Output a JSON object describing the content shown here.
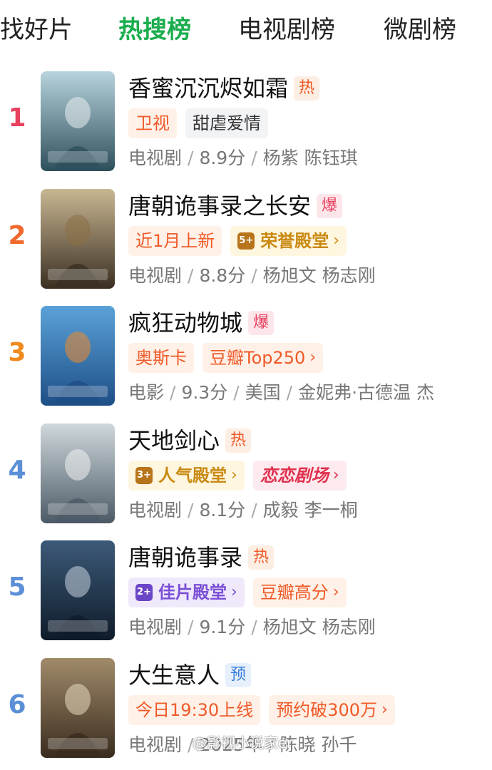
{
  "tabs": [
    {
      "label": "找好片",
      "active": false
    },
    {
      "label": "热搜榜",
      "active": true
    },
    {
      "label": "电视剧榜",
      "active": false
    },
    {
      "label": "微剧榜",
      "active": false
    }
  ],
  "items": [
    {
      "rank": "1",
      "rank_color": "#e8405f",
      "title": "香蜜沉沉烬如霜",
      "badge": "热",
      "badge_style": "hot",
      "tags": [
        {
          "text": "卫视",
          "style": "orange"
        },
        {
          "text": "甜虐爱情",
          "style": "gray"
        }
      ],
      "meta": [
        "电视剧",
        "8.9分",
        "杨紫 陈钰琪"
      ],
      "poster": {
        "bg1": "#b7d4dc",
        "bg2": "#2e4f5c",
        "accent": "#e9eef0"
      }
    },
    {
      "rank": "2",
      "rank_color": "#ef6a2c",
      "title": "唐朝诡事录之长安",
      "badge": "爆",
      "badge_style": "boom",
      "tags": [
        {
          "text": "近1月上新",
          "style": "orange"
        },
        {
          "text": "荣誉殿堂",
          "style": "gold",
          "medal": "5+",
          "chevron": true
        }
      ],
      "meta": [
        "电视剧",
        "8.8分",
        "杨旭文 杨志刚"
      ],
      "poster": {
        "bg1": "#c9b793",
        "bg2": "#3a2f22",
        "accent": "#8a6f45"
      }
    },
    {
      "rank": "3",
      "rank_color": "#f08a1e",
      "title": "疯狂动物城",
      "badge": "爆",
      "badge_style": "boom",
      "tags": [
        {
          "text": "奥斯卡",
          "style": "orange"
        },
        {
          "text": "豆瓣Top250",
          "style": "orange",
          "chevron": true
        }
      ],
      "meta": [
        "电影",
        "9.3分",
        "美国",
        "金妮弗·古德温 杰"
      ],
      "poster": {
        "bg1": "#5aa2d8",
        "bg2": "#1e4e86",
        "accent": "#f08a2c"
      }
    },
    {
      "rank": "4",
      "rank_color": "#5b8fd6",
      "title": "天地剑心",
      "badge": "热",
      "badge_style": "hot",
      "tags": [
        {
          "text": "人气殿堂",
          "style": "gold",
          "medal": "3+",
          "chevron": true
        },
        {
          "text": "恋恋剧场",
          "style": "pink",
          "chevron": true
        }
      ],
      "meta": [
        "电视剧",
        "8.1分",
        "成毅 李一桐"
      ],
      "poster": {
        "bg1": "#cfd8dc",
        "bg2": "#4c5a66",
        "accent": "#f2f2f2"
      }
    },
    {
      "rank": "5",
      "rank_color": "#5b8fd6",
      "title": "唐朝诡事录",
      "badge": "热",
      "badge_style": "hot",
      "tags": [
        {
          "text": "佳片殿堂",
          "style": "purple",
          "medal": "2+",
          "chevron": true
        },
        {
          "text": "豆瓣高分",
          "style": "orange",
          "chevron": true
        }
      ],
      "meta": [
        "电视剧",
        "9.1分",
        "杨旭文 杨志刚"
      ],
      "poster": {
        "bg1": "#3c5a78",
        "bg2": "#0f1b2a",
        "accent": "#c8d4e0"
      }
    },
    {
      "rank": "6",
      "rank_color": "#5b8fd6",
      "title": "大生意人",
      "badge": "预",
      "badge_style": "pre",
      "tags": [
        {
          "text": "今日19:30上线",
          "style": "orange"
        },
        {
          "text": "预约破300万",
          "style": "orange",
          "chevron": true
        }
      ],
      "meta": [
        "电视剧",
        "2025年",
        "陈晓 孙千"
      ],
      "poster": {
        "bg1": "#a08a6a",
        "bg2": "#3a2c1e",
        "accent": "#e8dcc0"
      }
    }
  ],
  "chevron": "›",
  "watermark": "@影视小说家er",
  "colors": {
    "accent": "#1aad4d",
    "orange_text": "#f05a28",
    "orange_bg": "#fff1e8",
    "gray_bg": "#f2f3f5",
    "gold_text": "#c98a12",
    "gold_bg": "#fff6e0",
    "purple_text": "#7a4fd6",
    "purple_bg": "#efe9fb",
    "pink_text": "#e0304e",
    "pink_bg": "#fdeaee"
  }
}
